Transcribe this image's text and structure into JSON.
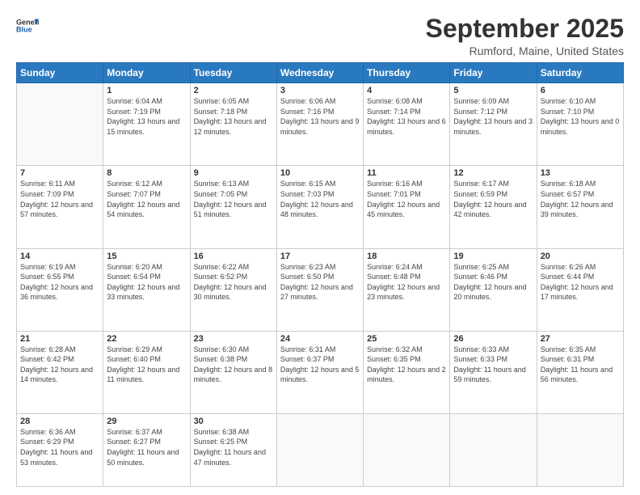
{
  "logo": {
    "line1": "General",
    "line2": "Blue",
    "icon_color": "#1a5fa8"
  },
  "header": {
    "month": "September 2025",
    "location": "Rumford, Maine, United States"
  },
  "weekdays": [
    "Sunday",
    "Monday",
    "Tuesday",
    "Wednesday",
    "Thursday",
    "Friday",
    "Saturday"
  ],
  "weeks": [
    [
      {
        "day": "",
        "sunrise": "",
        "sunset": "",
        "daylight": ""
      },
      {
        "day": "1",
        "sunrise": "Sunrise: 6:04 AM",
        "sunset": "Sunset: 7:19 PM",
        "daylight": "Daylight: 13 hours and 15 minutes."
      },
      {
        "day": "2",
        "sunrise": "Sunrise: 6:05 AM",
        "sunset": "Sunset: 7:18 PM",
        "daylight": "Daylight: 13 hours and 12 minutes."
      },
      {
        "day": "3",
        "sunrise": "Sunrise: 6:06 AM",
        "sunset": "Sunset: 7:16 PM",
        "daylight": "Daylight: 13 hours and 9 minutes."
      },
      {
        "day": "4",
        "sunrise": "Sunrise: 6:08 AM",
        "sunset": "Sunset: 7:14 PM",
        "daylight": "Daylight: 13 hours and 6 minutes."
      },
      {
        "day": "5",
        "sunrise": "Sunrise: 6:09 AM",
        "sunset": "Sunset: 7:12 PM",
        "daylight": "Daylight: 13 hours and 3 minutes."
      },
      {
        "day": "6",
        "sunrise": "Sunrise: 6:10 AM",
        "sunset": "Sunset: 7:10 PM",
        "daylight": "Daylight: 13 hours and 0 minutes."
      }
    ],
    [
      {
        "day": "7",
        "sunrise": "Sunrise: 6:11 AM",
        "sunset": "Sunset: 7:09 PM",
        "daylight": "Daylight: 12 hours and 57 minutes."
      },
      {
        "day": "8",
        "sunrise": "Sunrise: 6:12 AM",
        "sunset": "Sunset: 7:07 PM",
        "daylight": "Daylight: 12 hours and 54 minutes."
      },
      {
        "day": "9",
        "sunrise": "Sunrise: 6:13 AM",
        "sunset": "Sunset: 7:05 PM",
        "daylight": "Daylight: 12 hours and 51 minutes."
      },
      {
        "day": "10",
        "sunrise": "Sunrise: 6:15 AM",
        "sunset": "Sunset: 7:03 PM",
        "daylight": "Daylight: 12 hours and 48 minutes."
      },
      {
        "day": "11",
        "sunrise": "Sunrise: 6:16 AM",
        "sunset": "Sunset: 7:01 PM",
        "daylight": "Daylight: 12 hours and 45 minutes."
      },
      {
        "day": "12",
        "sunrise": "Sunrise: 6:17 AM",
        "sunset": "Sunset: 6:59 PM",
        "daylight": "Daylight: 12 hours and 42 minutes."
      },
      {
        "day": "13",
        "sunrise": "Sunrise: 6:18 AM",
        "sunset": "Sunset: 6:57 PM",
        "daylight": "Daylight: 12 hours and 39 minutes."
      }
    ],
    [
      {
        "day": "14",
        "sunrise": "Sunrise: 6:19 AM",
        "sunset": "Sunset: 6:55 PM",
        "daylight": "Daylight: 12 hours and 36 minutes."
      },
      {
        "day": "15",
        "sunrise": "Sunrise: 6:20 AM",
        "sunset": "Sunset: 6:54 PM",
        "daylight": "Daylight: 12 hours and 33 minutes."
      },
      {
        "day": "16",
        "sunrise": "Sunrise: 6:22 AM",
        "sunset": "Sunset: 6:52 PM",
        "daylight": "Daylight: 12 hours and 30 minutes."
      },
      {
        "day": "17",
        "sunrise": "Sunrise: 6:23 AM",
        "sunset": "Sunset: 6:50 PM",
        "daylight": "Daylight: 12 hours and 27 minutes."
      },
      {
        "day": "18",
        "sunrise": "Sunrise: 6:24 AM",
        "sunset": "Sunset: 6:48 PM",
        "daylight": "Daylight: 12 hours and 23 minutes."
      },
      {
        "day": "19",
        "sunrise": "Sunrise: 6:25 AM",
        "sunset": "Sunset: 6:46 PM",
        "daylight": "Daylight: 12 hours and 20 minutes."
      },
      {
        "day": "20",
        "sunrise": "Sunrise: 6:26 AM",
        "sunset": "Sunset: 6:44 PM",
        "daylight": "Daylight: 12 hours and 17 minutes."
      }
    ],
    [
      {
        "day": "21",
        "sunrise": "Sunrise: 6:28 AM",
        "sunset": "Sunset: 6:42 PM",
        "daylight": "Daylight: 12 hours and 14 minutes."
      },
      {
        "day": "22",
        "sunrise": "Sunrise: 6:29 AM",
        "sunset": "Sunset: 6:40 PM",
        "daylight": "Daylight: 12 hours and 11 minutes."
      },
      {
        "day": "23",
        "sunrise": "Sunrise: 6:30 AM",
        "sunset": "Sunset: 6:38 PM",
        "daylight": "Daylight: 12 hours and 8 minutes."
      },
      {
        "day": "24",
        "sunrise": "Sunrise: 6:31 AM",
        "sunset": "Sunset: 6:37 PM",
        "daylight": "Daylight: 12 hours and 5 minutes."
      },
      {
        "day": "25",
        "sunrise": "Sunrise: 6:32 AM",
        "sunset": "Sunset: 6:35 PM",
        "daylight": "Daylight: 12 hours and 2 minutes."
      },
      {
        "day": "26",
        "sunrise": "Sunrise: 6:33 AM",
        "sunset": "Sunset: 6:33 PM",
        "daylight": "Daylight: 11 hours and 59 minutes."
      },
      {
        "day": "27",
        "sunrise": "Sunrise: 6:35 AM",
        "sunset": "Sunset: 6:31 PM",
        "daylight": "Daylight: 11 hours and 56 minutes."
      }
    ],
    [
      {
        "day": "28",
        "sunrise": "Sunrise: 6:36 AM",
        "sunset": "Sunset: 6:29 PM",
        "daylight": "Daylight: 11 hours and 53 minutes."
      },
      {
        "day": "29",
        "sunrise": "Sunrise: 6:37 AM",
        "sunset": "Sunset: 6:27 PM",
        "daylight": "Daylight: 11 hours and 50 minutes."
      },
      {
        "day": "30",
        "sunrise": "Sunrise: 6:38 AM",
        "sunset": "Sunset: 6:25 PM",
        "daylight": "Daylight: 11 hours and 47 minutes."
      },
      {
        "day": "",
        "sunrise": "",
        "sunset": "",
        "daylight": ""
      },
      {
        "day": "",
        "sunrise": "",
        "sunset": "",
        "daylight": ""
      },
      {
        "day": "",
        "sunrise": "",
        "sunset": "",
        "daylight": ""
      },
      {
        "day": "",
        "sunrise": "",
        "sunset": "",
        "daylight": ""
      }
    ]
  ]
}
